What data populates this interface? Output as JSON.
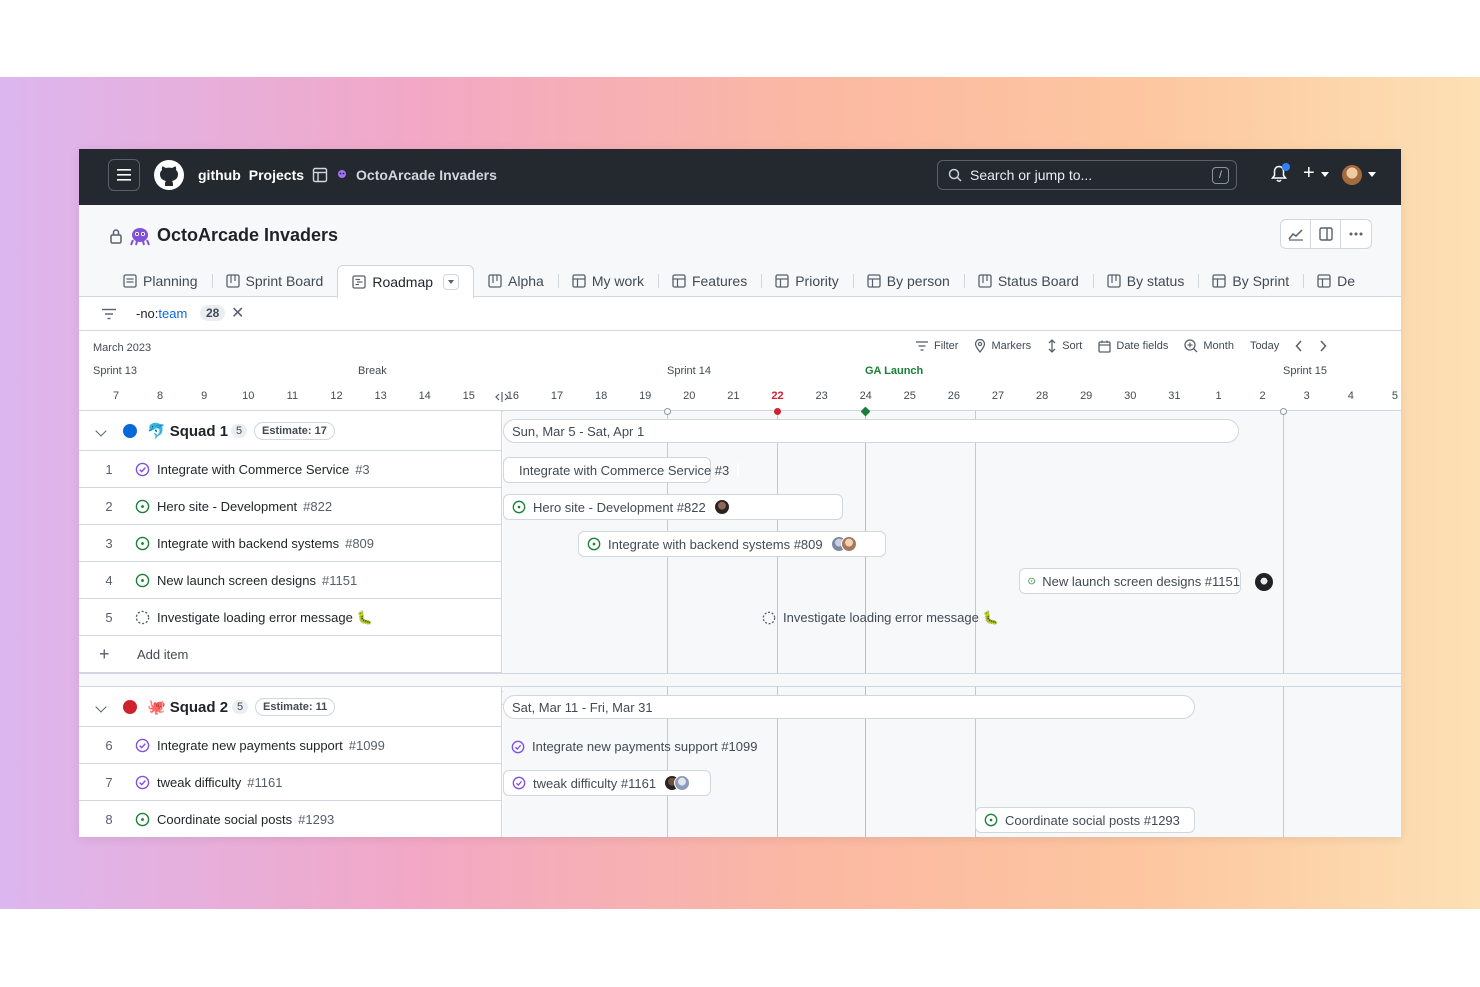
{
  "header": {
    "org": "github",
    "projects": "Projects",
    "project": "OctoArcade Invaders",
    "search_placeholder": "Search or jump to...",
    "search_shortcut": "/"
  },
  "project": {
    "title": "OctoArcade Invaders"
  },
  "tabs": [
    {
      "label": "Planning",
      "icon": "table-icon"
    },
    {
      "label": "Sprint Board",
      "icon": "board-icon"
    },
    {
      "label": "Roadmap",
      "icon": "roadmap-icon",
      "active": true
    },
    {
      "label": "Alpha",
      "icon": "board-icon"
    },
    {
      "label": "My work",
      "icon": "table-icon"
    },
    {
      "label": "Features",
      "icon": "table-icon"
    },
    {
      "label": "Priority",
      "icon": "table-icon"
    },
    {
      "label": "By person",
      "icon": "table-icon"
    },
    {
      "label": "Status Board",
      "icon": "board-icon"
    },
    {
      "label": "By status",
      "icon": "board-icon"
    },
    {
      "label": "By Sprint",
      "icon": "table-icon"
    },
    {
      "label": "De",
      "icon": "table-icon"
    }
  ],
  "filter": {
    "prefix": "-no:",
    "keyword": "team",
    "count": "28"
  },
  "timeline": {
    "month": "March 2023",
    "tools": {
      "filter": "Filter",
      "markers": "Markers",
      "sort": "Sort",
      "date_fields": "Date fields",
      "zoom": "Month",
      "today": "Today"
    },
    "sprints": {
      "s13": "Sprint 13",
      "brk": "Break",
      "s14": "Sprint 14",
      "ga": "GA Launch",
      "s15": "Sprint 15"
    },
    "days": [
      "7",
      "8",
      "9",
      "10",
      "11",
      "12",
      "13",
      "14",
      "15",
      "16",
      "17",
      "18",
      "19",
      "20",
      "21",
      "22",
      "23",
      "24",
      "25",
      "26",
      "27",
      "28",
      "29",
      "30",
      "31",
      "1",
      "2",
      "3",
      "4",
      "5"
    ],
    "today_index": 15
  },
  "groups": [
    {
      "name": "Squad 1",
      "count": "5",
      "estimate": "Estimate: 17",
      "dot_color": "#0969da",
      "range": "Sun, Mar 5 - Sat, Apr 1",
      "items": [
        {
          "num": "1",
          "title": "Integrate with Commerce Service",
          "ref": "#3",
          "status": "done"
        },
        {
          "num": "2",
          "title": "Hero site - Development",
          "ref": "#822",
          "status": "open"
        },
        {
          "num": "3",
          "title": "Integrate with backend systems",
          "ref": "#809",
          "status": "open"
        },
        {
          "num": "4",
          "title": "New launch screen designs",
          "ref": "#1151",
          "status": "open"
        },
        {
          "num": "5",
          "title": "Investigate loading error message 🐛",
          "ref": "",
          "status": "draft"
        }
      ],
      "add_item": "Add item"
    },
    {
      "name": "Squad 2",
      "count": "5",
      "estimate": "Estimate: 11",
      "dot_color": "#cf222e",
      "range": "Sat, Mar 11 - Fri, Mar 31",
      "items": [
        {
          "num": "6",
          "title": "Integrate new payments support",
          "ref": "#1099",
          "status": "done"
        },
        {
          "num": "7",
          "title": "tweak difficulty",
          "ref": "#1161",
          "status": "done"
        },
        {
          "num": "8",
          "title": "Coordinate social posts",
          "ref": "#1293",
          "status": "open"
        }
      ]
    }
  ],
  "bars": [
    {
      "text": "Integrate with Commerce Service #3"
    },
    {
      "text": "Hero site - Development #822"
    },
    {
      "text": "Integrate with backend systems #809"
    },
    {
      "text": "New launch screen designs #1151"
    },
    {
      "text": "Investigate loading error message 🐛"
    },
    {
      "text": "Integrate new payments support #1099"
    },
    {
      "text": "tweak difficulty #1161"
    },
    {
      "text": "Coordinate social posts #1293"
    }
  ],
  "colors": {
    "header_bg": "#24292f",
    "done": "#8250df",
    "open": "#1a7f37",
    "today": "#cf222e",
    "ga": "#1a7f37"
  }
}
